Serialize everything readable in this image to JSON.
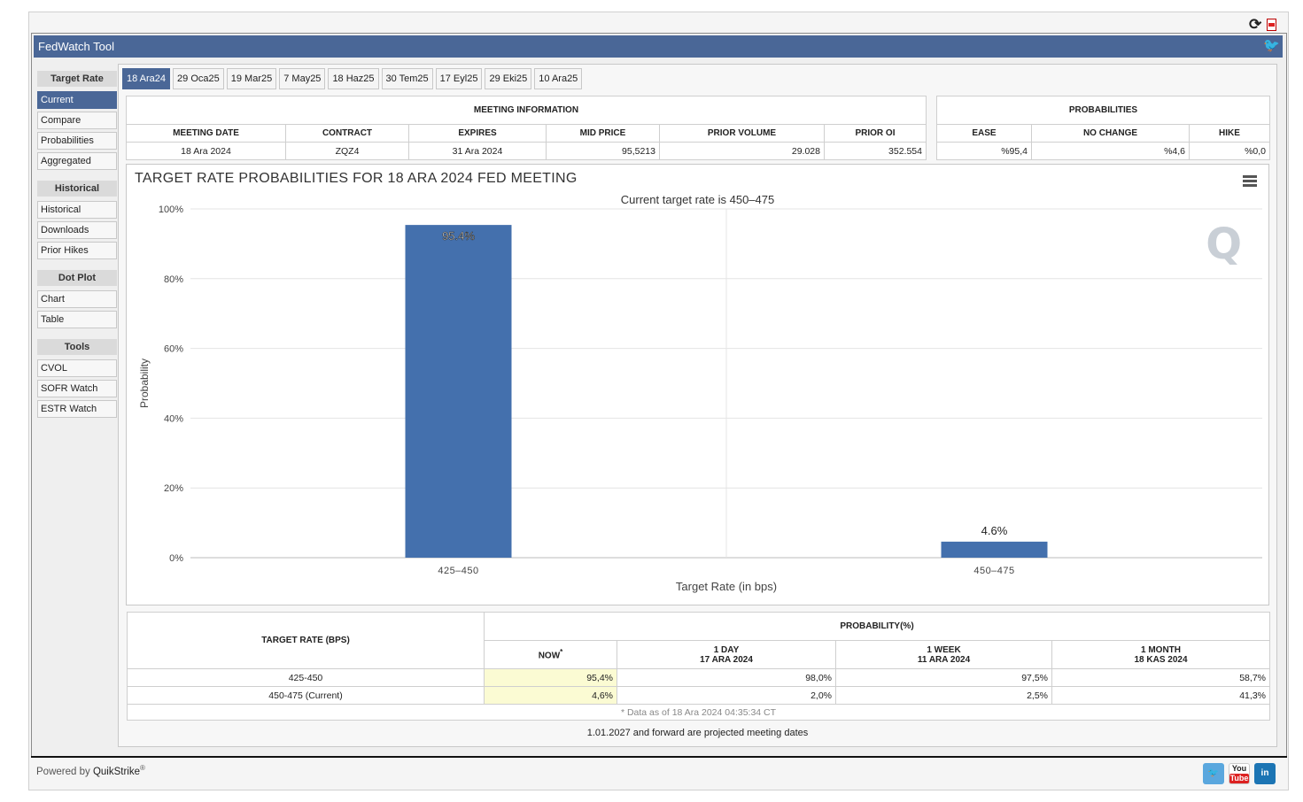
{
  "app": {
    "title": "FedWatch Tool",
    "powered_by_prefix": "Powered by ",
    "powered_by_brand": "QuikStrike",
    "powered_by_mark": "®"
  },
  "top_icons": [
    "refresh-icon",
    "pdf-icon"
  ],
  "sidebar": {
    "sections": [
      {
        "title": "Target Rate",
        "items": [
          "Current",
          "Compare",
          "Probabilities",
          "Aggregated"
        ],
        "active": "Current"
      },
      {
        "title": "Historical",
        "items": [
          "Historical",
          "Downloads",
          "Prior Hikes"
        ]
      },
      {
        "title": "Dot Plot",
        "items": [
          "Chart",
          "Table"
        ]
      },
      {
        "title": "Tools",
        "items": [
          "CVOL",
          "SOFR Watch",
          "ESTR Watch"
        ]
      }
    ]
  },
  "tabs": [
    "18 Ara24",
    "29 Oca25",
    "19 Mar25",
    "7 May25",
    "18 Haz25",
    "30 Tem25",
    "17 Eyl25",
    "29 Eki25",
    "10 Ara25"
  ],
  "active_tab": "18 Ara24",
  "meeting_info": {
    "title": "MEETING INFORMATION",
    "headers": [
      "MEETING DATE",
      "CONTRACT",
      "EXPIRES",
      "MID PRICE",
      "PRIOR VOLUME",
      "PRIOR OI"
    ],
    "values": [
      "18 Ara 2024",
      "ZQZ4",
      "31 Ara 2024",
      "95,5213",
      "29.028",
      "352.554"
    ]
  },
  "probabilities": {
    "title": "PROBABILITIES",
    "headers": [
      "EASE",
      "NO CHANGE",
      "HIKE"
    ],
    "values": [
      "%95,4",
      "%4,6",
      "%0,0"
    ]
  },
  "chart_data": {
    "type": "bar",
    "title": "TARGET RATE PROBABILITIES FOR 18 ARA 2024 FED MEETING",
    "subtitle": "Current target rate is 450–475",
    "xlabel": "Target Rate (in bps)",
    "ylabel": "Probability",
    "categories": [
      "425–450",
      "450–475"
    ],
    "values": [
      95.4,
      4.6
    ],
    "value_labels": [
      "95.4%",
      "4.6%"
    ],
    "ylim": [
      0,
      100
    ],
    "yticks": [
      "0%",
      "20%",
      "40%",
      "60%",
      "80%",
      "100%"
    ],
    "bar_color": "#4470ad",
    "grid": true
  },
  "prob_table": {
    "col_target": "TARGET RATE (BPS)",
    "col_group": "PROBABILITY(%)",
    "now": "NOW",
    "now_mark": "*",
    "cols": [
      {
        "label": "1 DAY",
        "date": "17 ARA 2024"
      },
      {
        "label": "1 WEEK",
        "date": "11 ARA 2024"
      },
      {
        "label": "1 MONTH",
        "date": "18 KAS 2024"
      }
    ],
    "rows": [
      {
        "rate": "425-450",
        "now": "95,4%",
        "d1": "98,0%",
        "w1": "97,5%",
        "m1": "58,7%"
      },
      {
        "rate": "450-475 (Current)",
        "now": "4,6%",
        "d1": "2,0%",
        "w1": "2,5%",
        "m1": "41,3%"
      }
    ],
    "note": "* Data as of 18 Ara 2024 04:35:34 CT"
  },
  "projected_note": "1.01.2027 and forward are projected meeting dates",
  "social": [
    "twitter-icon",
    "youtube-icon",
    "linkedin-icon"
  ],
  "social_text": {
    "youtube_top": "You",
    "youtube_bottom": "Tube",
    "linkedin": "in"
  }
}
